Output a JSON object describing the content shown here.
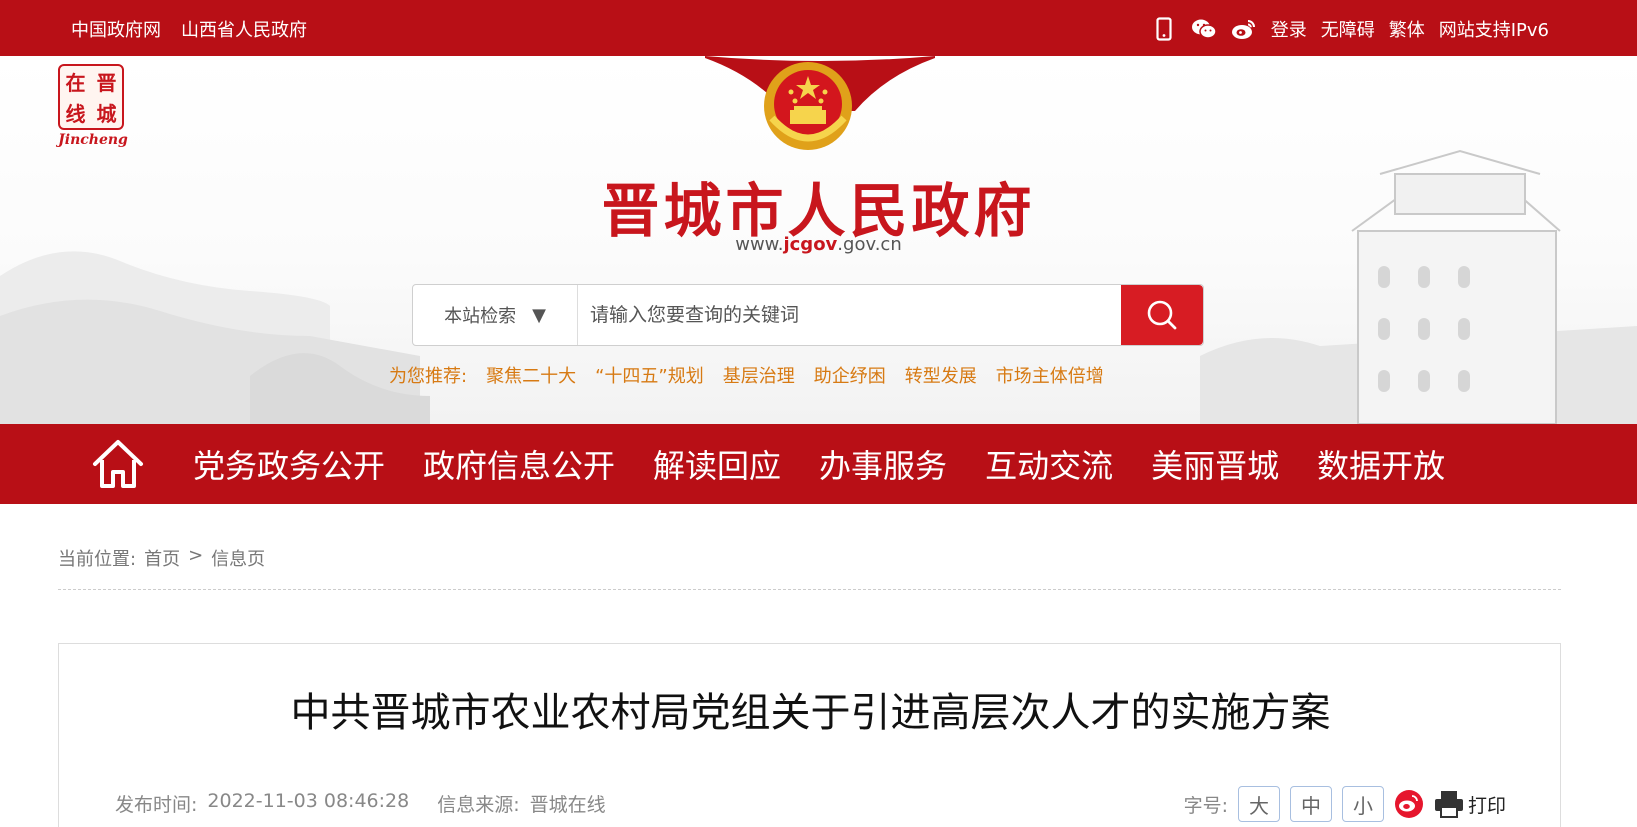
{
  "topbar": {
    "links": [
      "中国政府网",
      "山西省人民政府"
    ],
    "login": "登录",
    "accessibility": "无障碍",
    "traditional": "繁体",
    "ipv6": "网站支持IPv6"
  },
  "logo": {
    "chars": [
      "在",
      "晋",
      "线",
      "城"
    ],
    "caption": "Jincheng"
  },
  "header": {
    "site_title": "晋城市人民政府",
    "url_prefix": "www.",
    "url_bold": "jcgov",
    "url_suffix": ".gov.cn"
  },
  "search": {
    "scope_label": "本站检索",
    "placeholder": "请输入您要查询的关键词"
  },
  "recommend": {
    "label": "为您推荐:",
    "items": [
      "聚焦二十大",
      "“十四五”规划",
      "基层治理",
      "助企纾困",
      "转型发展",
      "市场主体倍增"
    ]
  },
  "nav": {
    "items": [
      "党务政务公开",
      "政府信息公开",
      "解读回应",
      "办事服务",
      "互动交流",
      "美丽晋城",
      "数据开放"
    ]
  },
  "breadcrumb": {
    "label": "当前位置:",
    "home": "首页",
    "sep": ">",
    "current": "信息页"
  },
  "article": {
    "title": "中共晋城市农业农村局党组关于引进高层次人才的实施方案",
    "publish_label": "发布时间:",
    "publish_time": "2022-11-03 08:46:28",
    "source_label": "信息来源:",
    "source": "晋城在线",
    "font_label": "字号:",
    "font_large": "大",
    "font_medium": "中",
    "font_small": "小",
    "print": "打印"
  },
  "colors": {
    "brand_red": "#b80f16",
    "search_red": "#d71c23",
    "recommend_orange": "#d77a13"
  }
}
